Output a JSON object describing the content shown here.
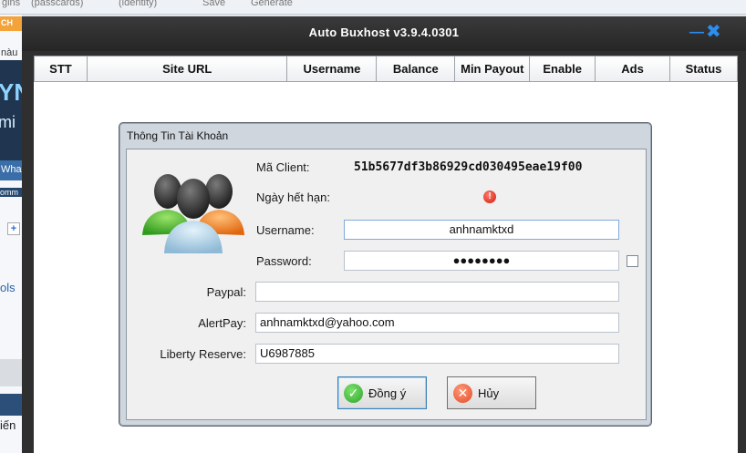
{
  "background": {
    "toolbar_fragments": [
      "gins",
      "(passcards)",
      "(identity)",
      "Save",
      "Generate"
    ],
    "left_fragments": [
      "CH",
      "nàu",
      "YN",
      "mi",
      "Wha",
      "omm",
      "+",
      "ols",
      "iến"
    ]
  },
  "window": {
    "title": "Auto Buxhost v3.9.4.0301",
    "minimize_glyph": "—",
    "close_glyph": "✖",
    "columns": [
      "STT",
      "Site URL",
      "Username",
      "Balance",
      "Min Payout",
      "Enable",
      "Ads",
      "Status"
    ]
  },
  "dialog": {
    "title": "Thông Tin Tài Khoản",
    "icon": "users-group-icon",
    "client_label": "Mã Client:",
    "client_value": "51b5677df3b86929cd030495eae19f00",
    "expiry_label": "Ngày hết hạn:",
    "expiry_status_icon": "error-icon",
    "username_label": "Username:",
    "username_value": "anhnamktxd",
    "password_label": "Password:",
    "password_value": "●●●●●●●●",
    "paypal_label": "Paypal:",
    "paypal_value": "",
    "alertpay_label": "AlertPay:",
    "alertpay_value": "anhnamktxd@yahoo.com",
    "liberty_label": "Liberty Reserve:",
    "liberty_value": "U6987885",
    "ok_label": "Đồng ý",
    "cancel_label": "Hủy"
  },
  "colors": {
    "accent": "#2b8ef0",
    "ok_green": "#2fa32f",
    "cancel_red": "#e24a2a"
  }
}
